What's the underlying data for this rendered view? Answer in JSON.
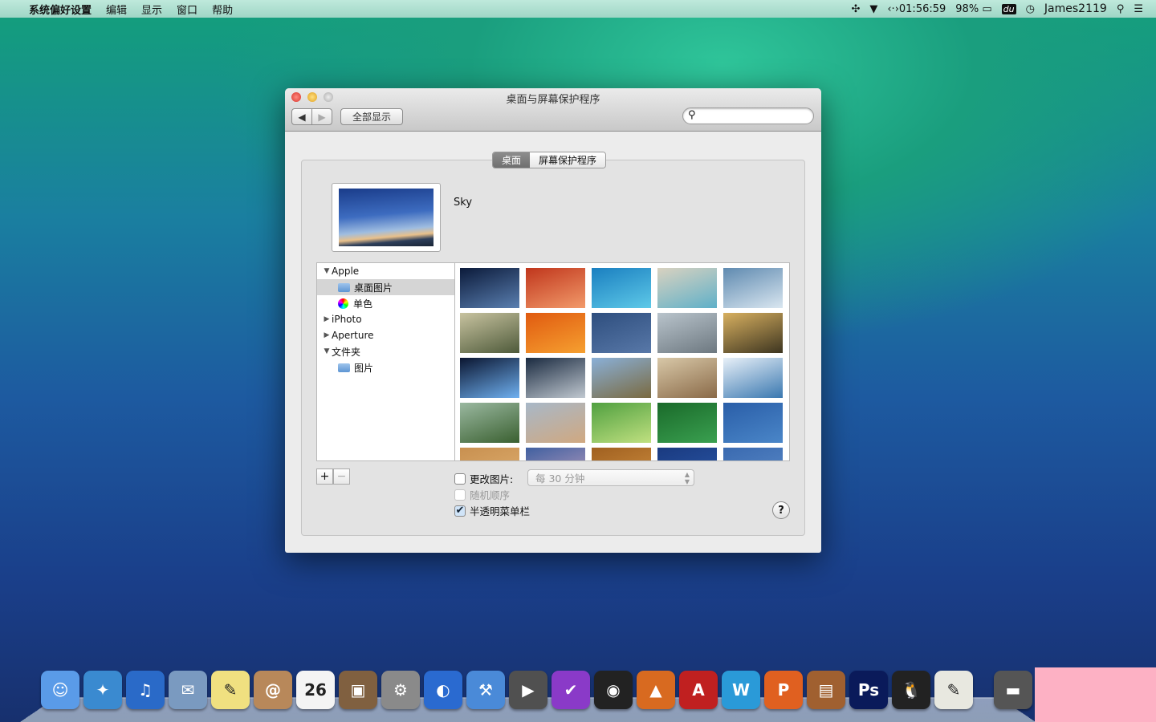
{
  "menubar": {
    "app": "系统偏好设置",
    "items": [
      "编辑",
      "显示",
      "窗口",
      "帮助"
    ],
    "clock": "01:56:59",
    "battery": "98%",
    "user": "James2119",
    "du": "du"
  },
  "window": {
    "title": "桌面与屏幕保护程序",
    "show_all": "全部显示",
    "search_placeholder": "",
    "tabs": [
      "桌面",
      "屏幕保护程序"
    ],
    "active_tab": "桌面",
    "current_wallpaper": "Sky",
    "sidebar": [
      {
        "label": "Apple",
        "level": 0,
        "arrow": "▼"
      },
      {
        "label": "桌面图片",
        "level": 1,
        "icon": "folder",
        "selected": true
      },
      {
        "label": "单色",
        "level": 1,
        "icon": "color-wheel"
      },
      {
        "label": "iPhoto",
        "level": 0,
        "arrow": "▶"
      },
      {
        "label": "Aperture",
        "level": 0,
        "arrow": "▶"
      },
      {
        "label": "文件夹",
        "level": 0,
        "arrow": "▼"
      },
      {
        "label": "图片",
        "level": 1,
        "icon": "folder"
      }
    ],
    "thumbnails": [
      [
        "#0b1a3a",
        "#5a7fb0"
      ],
      [
        "#c0361c",
        "#f29a6a"
      ],
      [
        "#1a7fc0",
        "#5ec9e8"
      ],
      [
        "#d9d2c0",
        "#5fb0c8"
      ],
      [
        "#5f8ab0",
        "#d9e6f0"
      ],
      [
        "#c8c3a0",
        "#4e5a3a"
      ],
      [
        "#e05a10",
        "#f6a030"
      ],
      [
        "#2e4e7e",
        "#5878a8"
      ],
      [
        "#b9c4cc",
        "#6d7880"
      ],
      [
        "#d8b060",
        "#3d3520"
      ],
      [
        "#0a1530",
        "#6fb0f0"
      ],
      [
        "#1a2a40",
        "#c0c8d0"
      ],
      [
        "#8ab0d8",
        "#7a6a40"
      ],
      [
        "#d8c8a8",
        "#8a6a48"
      ],
      [
        "#e8f0f8",
        "#3a78b0"
      ],
      [
        "#9ab8a0",
        "#3a6030"
      ],
      [
        "#a8b8c8",
        "#d0a880"
      ],
      [
        "#50a040",
        "#c0e080"
      ],
      [
        "#1a6a2a",
        "#3aa050"
      ],
      [
        "#2a5ea8",
        "#4a86c8"
      ],
      [
        "#c89050",
        "#e0b070"
      ],
      [
        "#4060a0",
        "#c0a0c0"
      ],
      [
        "#a06020",
        "#d09040"
      ],
      [
        "#1a3a80",
        "#2a58a8"
      ],
      [
        "#3a6ab0",
        "#5a8ac8"
      ]
    ],
    "add": "+",
    "remove": "−",
    "change_picture": {
      "label": "更改图片:",
      "checked": false
    },
    "interval": "每 30 分钟",
    "random_order": {
      "label": "随机顺序",
      "checked": false,
      "enabled": false
    },
    "translucent_menu": {
      "label": "半透明菜单栏",
      "checked": true
    },
    "help": "?"
  },
  "dock": [
    {
      "name": "finder",
      "color": "#5a9be8",
      "glyph": "☺"
    },
    {
      "name": "safari",
      "color": "#3a8ad0",
      "glyph": "✦"
    },
    {
      "name": "itunes",
      "color": "#2a6ac8",
      "glyph": "♫"
    },
    {
      "name": "mail",
      "color": "#7a9ac0",
      "glyph": "✉"
    },
    {
      "name": "stickies",
      "color": "#f0e080",
      "glyph": "✎"
    },
    {
      "name": "contacts",
      "color": "#b8885a",
      "glyph": "@"
    },
    {
      "name": "calendar",
      "color": "#f4f4f4",
      "glyph": "26"
    },
    {
      "name": "iphoto",
      "color": "#806040",
      "glyph": "▣"
    },
    {
      "name": "system-preferences",
      "color": "#8a8a8a",
      "glyph": "⚙"
    },
    {
      "name": "google-earth",
      "color": "#2a6ad0",
      "glyph": "◐"
    },
    {
      "name": "xcode",
      "color": "#4a8ad8",
      "glyph": "⚒"
    },
    {
      "name": "final-cut",
      "color": "#505050",
      "glyph": "▶"
    },
    {
      "name": "omnifocus",
      "color": "#8a3ac8",
      "glyph": "✔"
    },
    {
      "name": "photo-booth",
      "color": "#222222",
      "glyph": "◉"
    },
    {
      "name": "matlab",
      "color": "#d86a20",
      "glyph": "▲"
    },
    {
      "name": "autocad",
      "color": "#c02020",
      "glyph": "A"
    },
    {
      "name": "word",
      "color": "#2a9ad8",
      "glyph": "W"
    },
    {
      "name": "powerpoint",
      "color": "#e06020",
      "glyph": "P"
    },
    {
      "name": "keynote",
      "color": "#a06030",
      "glyph": "▤"
    },
    {
      "name": "photoshop",
      "color": "#0a1a5a",
      "glyph": "Ps"
    },
    {
      "name": "qq",
      "color": "#222222",
      "glyph": "🐧"
    },
    {
      "name": "textedit",
      "color": "#e8e8e0",
      "glyph": "✎"
    },
    {
      "name": "folder",
      "color": "#555555",
      "glyph": "▬"
    }
  ]
}
